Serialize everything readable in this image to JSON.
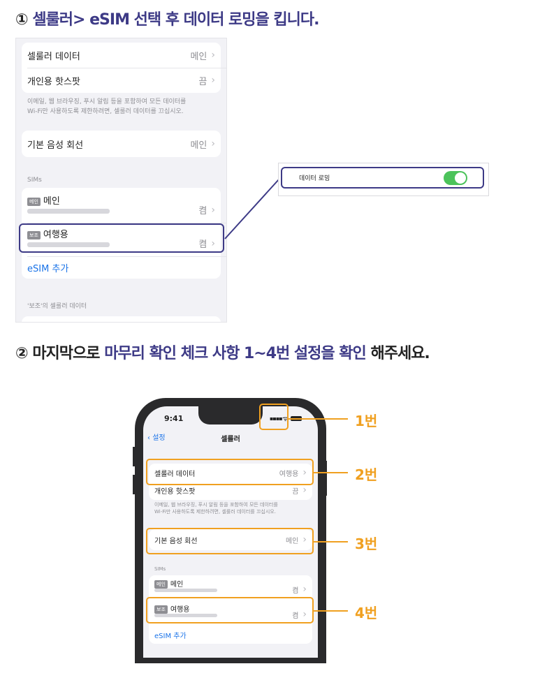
{
  "step1": {
    "num": "①",
    "text": "셀룰러> eSIM 선택 후 데이터 로밍을 킵니다."
  },
  "shot1": {
    "rows_top": [
      {
        "label": "셀룰러 데이터",
        "value": "메인"
      },
      {
        "label": "개인용 핫스팟",
        "value": "끔"
      }
    ],
    "footnote_line1": "이메일, 웹 브라우징, 푸시 알림 등을 포함하여 모든 데이터를",
    "footnote_line2": "Wi-Fi만 사용하도록 제한하려면, 셀룰러 데이터를 끄십시오.",
    "voice_label": "기본 음성 회선",
    "voice_value": "메인",
    "sims_header": "SIMs",
    "sim_main": {
      "badge": "메인",
      "label": "메인",
      "value": "켬"
    },
    "sim_travel": {
      "badge": "보조",
      "label": "여행용",
      "value": "켬"
    },
    "add_esim": "eSIM 추가",
    "secondary_header": "'보조'의 셀룰러 데이터"
  },
  "roaming": {
    "label": "데이터 로밍",
    "state": "on"
  },
  "step2": {
    "num": "②",
    "pre": "마지막으로",
    "highlight": "마무리 확인 체크 사항 1~4번 설정을 확인",
    "post": "해주세요."
  },
  "phone": {
    "time": "9:41",
    "back_label": "설정",
    "nav_title": "셀룰러",
    "cellular_data": {
      "label": "셀룰러 데이터",
      "value": "여행용"
    },
    "hotspot": {
      "label": "개인용 핫스팟",
      "value": "끔"
    },
    "footnote_line1": "이메일, 웹 브라우징, 푸시 알림 등을 포함하여 모든 데이터를",
    "footnote_line2": "Wi-Fi만 사용하도록 제한하려면, 셀룰러 데이터를 끄십시오.",
    "voice": {
      "label": "기본 음성 회선",
      "value": "메인"
    },
    "sims_header": "SIMs",
    "sim_main": {
      "badge": "메인",
      "label": "메인",
      "value": "켬"
    },
    "sim_travel": {
      "badge": "보조",
      "label": "여행용",
      "value": "켬"
    },
    "add_esim": "eSIM 추가"
  },
  "callouts": [
    "1번",
    "2번",
    "3번",
    "4번"
  ],
  "colors": {
    "accent_purple": "#3d3a86",
    "callout_orange": "#f0a020",
    "toggle_green": "#4cc35b",
    "link_blue": "#1a73e8"
  }
}
